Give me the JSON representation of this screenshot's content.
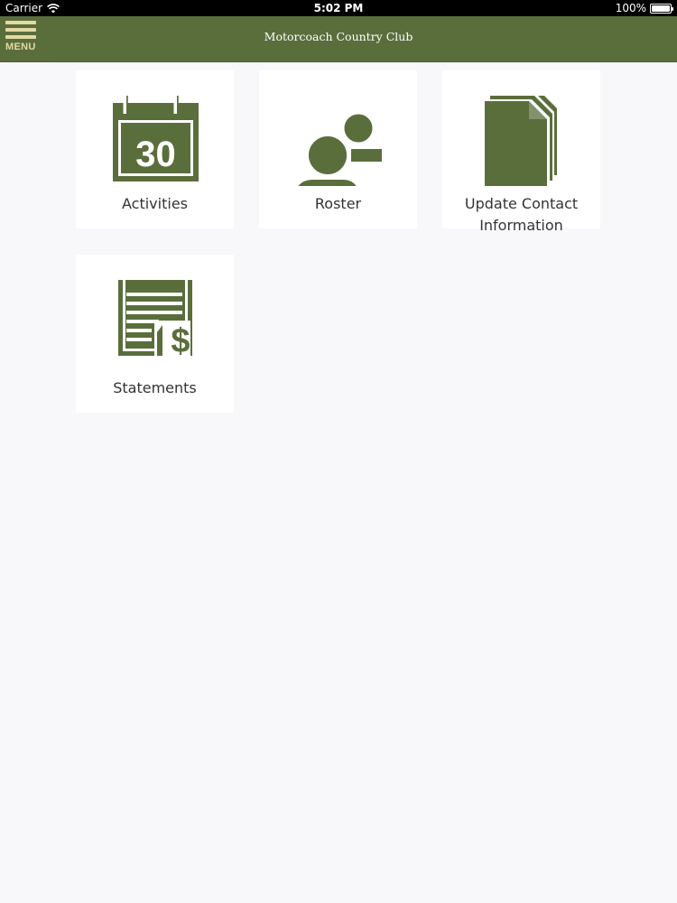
{
  "status_bar": {
    "carrier": "Carrier",
    "time": "5:02 PM",
    "battery": "100%"
  },
  "nav": {
    "menu_label": "MENU",
    "title": "Motorcoach Country Club"
  },
  "colors": {
    "accent": "#5a6e3c",
    "menu_text": "#e4d9a3"
  },
  "tiles": [
    {
      "label": "Activities",
      "icon": "calendar-icon",
      "icon_text": "30"
    },
    {
      "label": "Roster",
      "icon": "people-icon"
    },
    {
      "label": "Update Contact Information",
      "icon": "documents-icon"
    },
    {
      "label": "Statements",
      "icon": "statement-dollar-icon"
    }
  ]
}
